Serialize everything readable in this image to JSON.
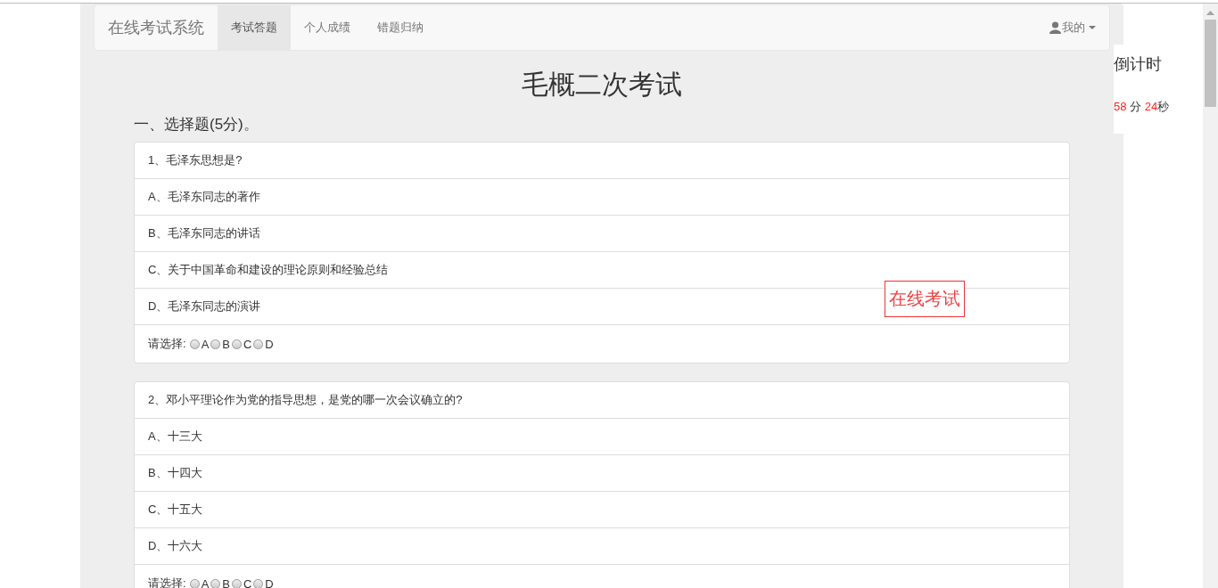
{
  "navbar": {
    "brand": "在线考试系统",
    "tabs": [
      {
        "label": "考试答题",
        "selected": true
      },
      {
        "label": "个人成绩",
        "selected": false
      },
      {
        "label": "错题归纳",
        "selected": false
      }
    ],
    "user_menu": "我的"
  },
  "exam_title": "毛概二次考试",
  "section_title": "一、选择题(5分)。",
  "questions": [
    {
      "stem": "1、毛泽东思想是?",
      "options": [
        "A、毛泽东同志的著作",
        "B、毛泽东同志的讲话",
        "C、关于中国革命和建设的理论原则和经验总结",
        "D、毛泽东同志的演讲"
      ],
      "choose_label": "请选择:",
      "choices": [
        {
          "label": "A",
          "selected": false
        },
        {
          "label": "B",
          "selected": false
        },
        {
          "label": "C",
          "selected": false
        },
        {
          "label": "D",
          "selected": false
        }
      ]
    },
    {
      "stem": "2、邓小平理论作为党的指导思想，是党的哪一次会议确立的?",
      "options": [
        "A、十三大",
        "B、十四大",
        "C、十五大",
        "D、十六大"
      ],
      "choose_label": "请选择:",
      "choices": [
        {
          "label": "A",
          "selected": false
        },
        {
          "label": "B",
          "selected": false
        },
        {
          "label": "C",
          "selected": false
        },
        {
          "label": "D",
          "selected": false
        }
      ]
    }
  ],
  "stamp": "在线考试",
  "countdown": {
    "title": "倒计时",
    "minutes": "58",
    "minutes_unit": "分",
    "seconds": "24",
    "seconds_unit": "秒"
  }
}
